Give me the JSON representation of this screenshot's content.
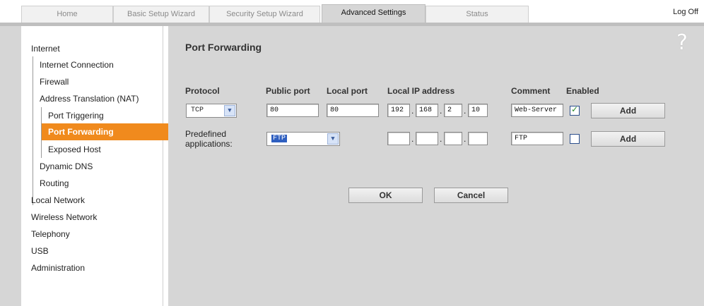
{
  "tabs": [
    "Home",
    "Basic Setup Wizard",
    "Security Setup Wizard",
    "Advanced Settings",
    "Status"
  ],
  "log_off": "Log Off",
  "sidebar": {
    "internet": "Internet",
    "internet_connection": "Internet Connection",
    "firewall": "Firewall",
    "nat": "Address Translation (NAT)",
    "port_triggering": "Port Triggering",
    "port_forwarding": "Port Forwarding",
    "exposed_host": "Exposed Host",
    "dynamic_dns": "Dynamic DNS",
    "routing": "Routing",
    "local_network": "Local Network",
    "wireless_network": "Wireless Network",
    "telephony": "Telephony",
    "usb": "USB",
    "administration": "Administration"
  },
  "page_title": "Port Forwarding",
  "help_icon": "?",
  "columns": {
    "protocol": "Protocol",
    "public_port": "Public port",
    "local_port": "Local port",
    "local_ip": "Local IP address",
    "comment": "Comment",
    "enabled": "Enabled"
  },
  "row1": {
    "protocol": "TCP",
    "public_port": "80",
    "local_port": "80",
    "ip": [
      "192",
      "168",
      "2",
      "10"
    ],
    "comment": "Web-Server",
    "enabled": true,
    "add_label": "Add"
  },
  "row2": {
    "label_line1": "Predefined",
    "label_line2": "applications:",
    "application": "FTP",
    "ip": [
      "",
      "",
      "",
      ""
    ],
    "comment": "FTP",
    "enabled": false,
    "add_label": "Add"
  },
  "ok_label": "OK",
  "cancel_label": "Cancel",
  "dot": "."
}
